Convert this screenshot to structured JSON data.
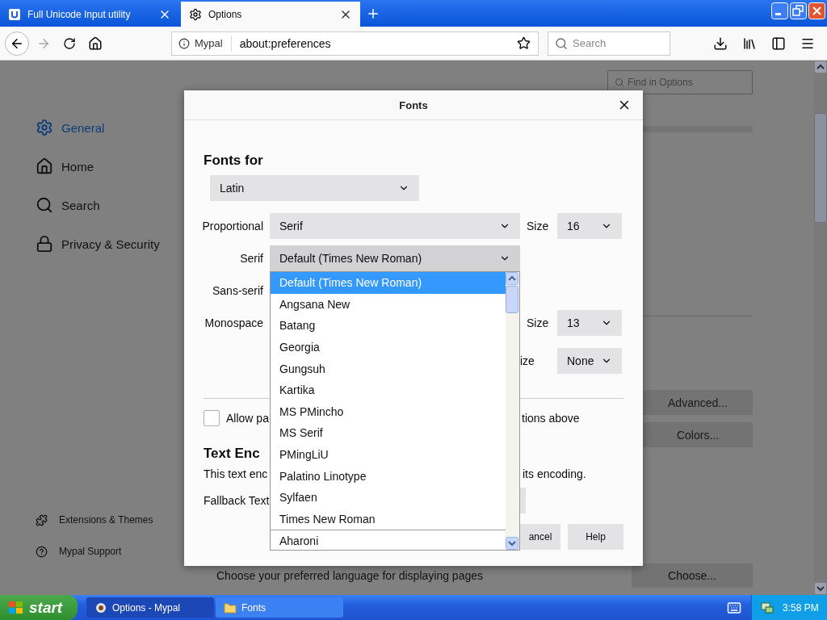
{
  "browser": {
    "tabs": [
      {
        "title": "Full Unicode Input utility",
        "selected": false
      },
      {
        "title": "Options",
        "selected": true
      }
    ],
    "nav": {
      "identity": "Mypal",
      "url": "about:preferences",
      "search_placeholder": "Search"
    }
  },
  "preferences": {
    "find_placeholder": "Find in Options",
    "sidebar": [
      {
        "label": "General",
        "selected": true
      },
      {
        "label": "Home",
        "selected": false
      },
      {
        "label": "Search",
        "selected": false
      },
      {
        "label": "Privacy & Security",
        "selected": false
      }
    ],
    "sidebar_footer": [
      "Extensions & Themes",
      "Mypal Support"
    ],
    "buttons": [
      "Advanced...",
      "Colors..."
    ],
    "language_text": "Choose your preferred language for displaying pages",
    "language_button": "Choose..."
  },
  "dialog": {
    "title": "Fonts",
    "heading": "Fonts for",
    "script_select": "Latin",
    "rows": [
      {
        "label": "Proportional",
        "value": "Serif",
        "expanded": false,
        "size_label": "Size",
        "size": "16"
      },
      {
        "label": "Serif",
        "value": "Default (Times New Roman)",
        "expanded": true
      },
      {
        "label": "Sans-serif"
      },
      {
        "label": "Monospace",
        "size_label": "Size",
        "size": "13"
      },
      {
        "size_label": "ize",
        "size": "None"
      }
    ],
    "checkbox": {
      "checked": false,
      "label_start": "Allow pa",
      "label_end": "tions above"
    },
    "encoding": {
      "heading": "Text Enc",
      "text_start": "This text enc",
      "text_end": "its encoding.",
      "fallback_label": "Fallback Text"
    },
    "buttons": [
      "ancel",
      "Help"
    ],
    "listbox": [
      {
        "label": "Default (Times New Roman)",
        "selected": true
      },
      {
        "label": "Angsana New",
        "selected": false
      },
      {
        "label": "Batang",
        "selected": false
      },
      {
        "label": "Georgia",
        "selected": false
      },
      {
        "label": "Gungsuh",
        "selected": false
      },
      {
        "label": "Kartika",
        "selected": false
      },
      {
        "label": "MS PMincho",
        "selected": false
      },
      {
        "label": "MS Serif",
        "selected": false
      },
      {
        "label": "PMingLiU",
        "selected": false
      },
      {
        "label": "Palatino Linotype",
        "selected": false
      },
      {
        "label": "Sylfaen",
        "selected": false
      },
      {
        "label": "Times New Roman",
        "selected": false
      },
      {
        "label": "Aharoni",
        "selected": false
      }
    ]
  },
  "taskbar": {
    "start": "start",
    "tasks": [
      {
        "label": "Options - Mypal",
        "selected": true
      },
      {
        "label": "Fonts",
        "selected": false
      }
    ],
    "clock": "3:58 PM"
  }
}
